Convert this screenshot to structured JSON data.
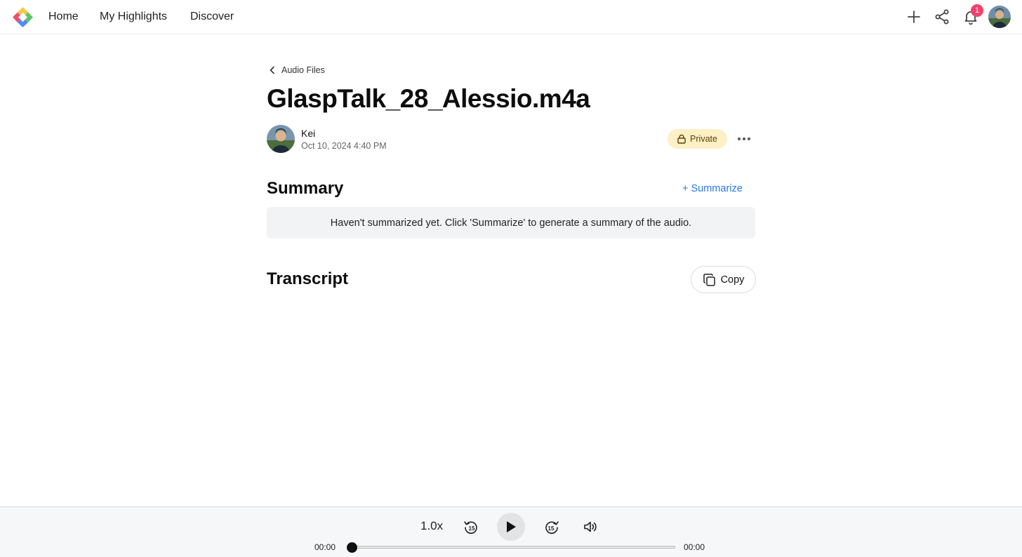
{
  "nav": {
    "home": "Home",
    "highlights": "My Highlights",
    "discover": "Discover",
    "notification_count": "1"
  },
  "icons": {
    "logo": "glasp-logo",
    "add": "plus-icon",
    "share": "share-icon",
    "notifications": "bell-icon",
    "back": "chevron-left-icon",
    "lock": "lock-icon",
    "more": "more-horizontal-icon",
    "copy": "copy-icon",
    "rewind": "rewind-15-icon",
    "play": "play-icon",
    "forward": "forward-15-icon",
    "volume": "volume-icon"
  },
  "breadcrumb": {
    "label": "Audio Files"
  },
  "page": {
    "title": "GlaspTalk_28_Alessio.m4a"
  },
  "author": {
    "name": "Kei",
    "date": "Oct 10, 2024 4:40 PM"
  },
  "visibility": {
    "label": "Private"
  },
  "summary": {
    "heading": "Summary",
    "action": "+ Summarize",
    "empty_text": "Haven't summarized yet. Click 'Summarize' to generate a summary of the audio."
  },
  "transcript": {
    "heading": "Transcript",
    "copy_label": "Copy"
  },
  "player": {
    "speed": "1.0x",
    "current_time": "00:00",
    "duration": "00:00",
    "progress": 0
  },
  "colors": {
    "accent_link": "#2a7ae2",
    "badge": "#f0416c",
    "private_bg": "#fdf0c4"
  }
}
